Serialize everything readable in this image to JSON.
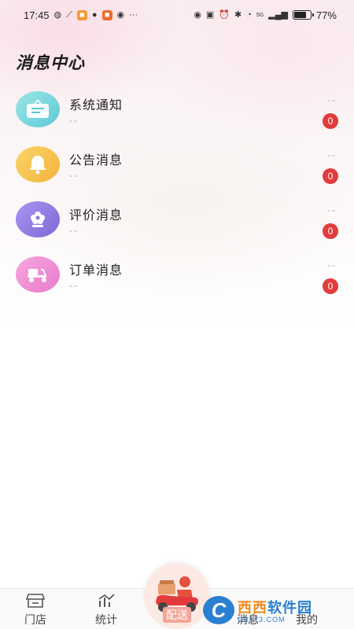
{
  "status_bar": {
    "time": "17:45",
    "battery_text": "77%",
    "battery_level": 0.77,
    "network_label": "5G"
  },
  "page": {
    "title": "消息中心"
  },
  "messages": [
    {
      "title": "系统通知",
      "subtitle": "--",
      "time": "--",
      "badge": "0",
      "icon": "notice-board-icon",
      "color": "#7fd7dc"
    },
    {
      "title": "公告消息",
      "subtitle": "--",
      "time": "--",
      "badge": "0",
      "icon": "bell-icon",
      "color": "#f6c24e"
    },
    {
      "title": "评价消息",
      "subtitle": "--",
      "time": "--",
      "badge": "0",
      "icon": "flower-icon",
      "color": "#9a84e6"
    },
    {
      "title": "订单消息",
      "subtitle": "--",
      "time": "--",
      "badge": "0",
      "icon": "scooter-icon",
      "color": "#ef8fd5"
    }
  ],
  "bottom_nav": {
    "store": "门店",
    "stats": "统计",
    "delivery": "配送",
    "messages": "消息",
    "mine": "我的"
  },
  "watermark": {
    "main_1": "西西",
    "main_2": "软件园",
    "sub": "CR173.COM",
    "logo": "C"
  },
  "colors": {
    "badge": "#e23b3b",
    "accent": "#e23b3b"
  }
}
